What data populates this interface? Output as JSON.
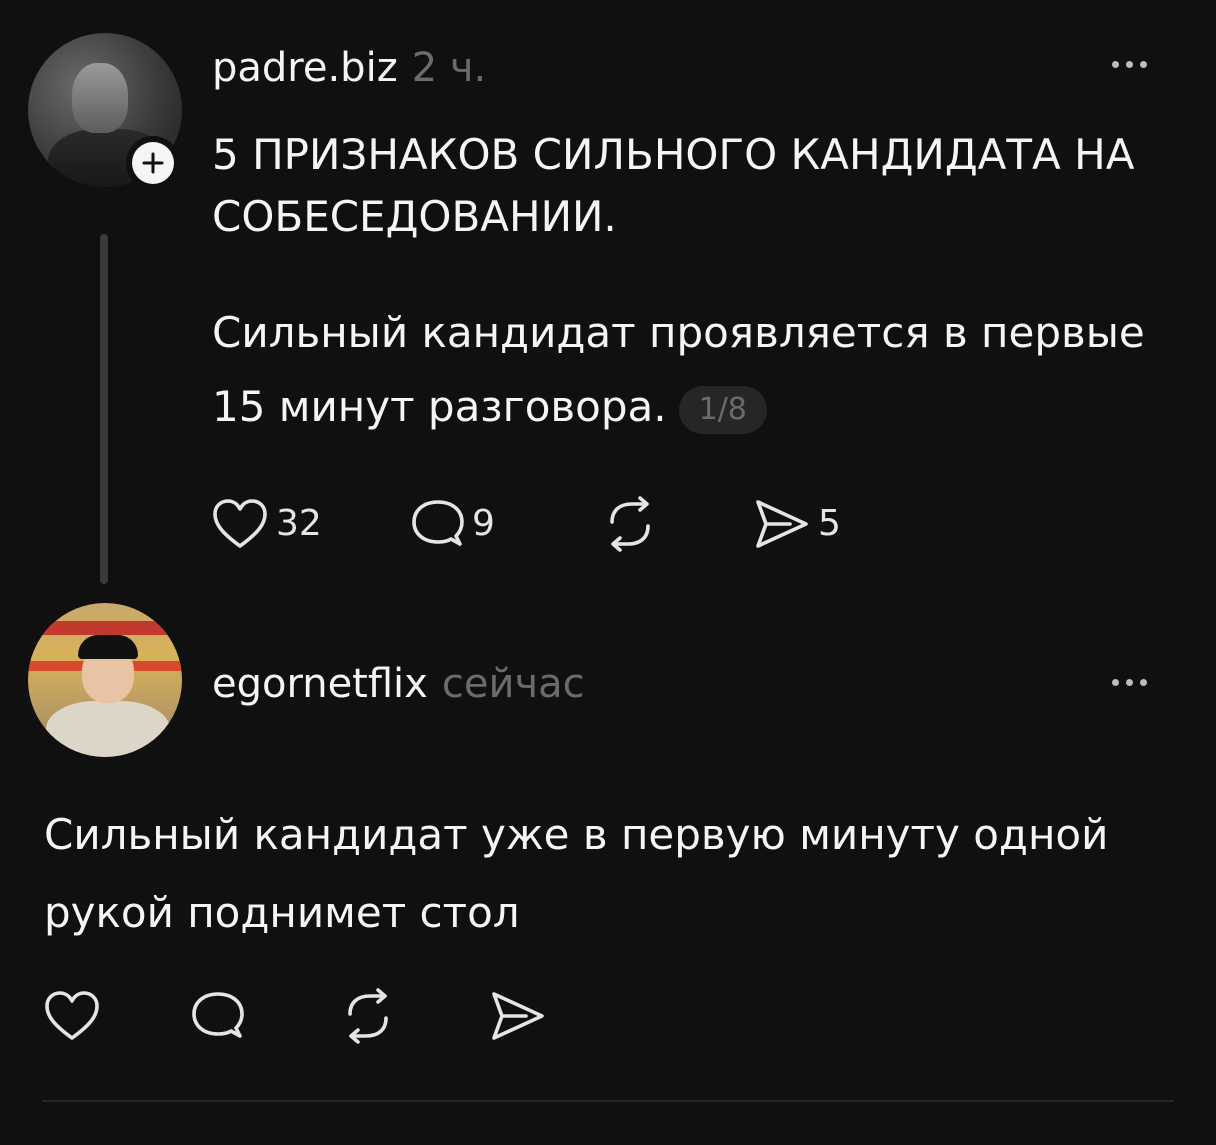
{
  "post": {
    "username": "padre.biz",
    "time": "2 ч.",
    "headline": "5 ПРИЗНАКОВ СИЛЬНОГО КАНДИДАТА НА СОБЕСЕДОВАНИИ.",
    "body": "Сильный кандидат проявляется в первые 15 минут разговора.",
    "page_counter": "1/8",
    "likes": "32",
    "comments": "9",
    "reposts": "",
    "shares": "5"
  },
  "reply": {
    "username": "egornetflix",
    "time": "сейчас",
    "text": "Сильный кандидат уже в первую минуту одной рукой поднимет стол"
  },
  "icons": {
    "like": "heart-icon",
    "comment": "comment-bubble-icon",
    "repost": "repost-arrows-icon",
    "share": "send-icon",
    "more": "more-dots-icon",
    "follow": "plus-icon"
  },
  "colors": {
    "background": "#101010",
    "text": "#f3f5f7",
    "muted": "#6b6b6b",
    "thread_line": "#3a3a3a"
  }
}
